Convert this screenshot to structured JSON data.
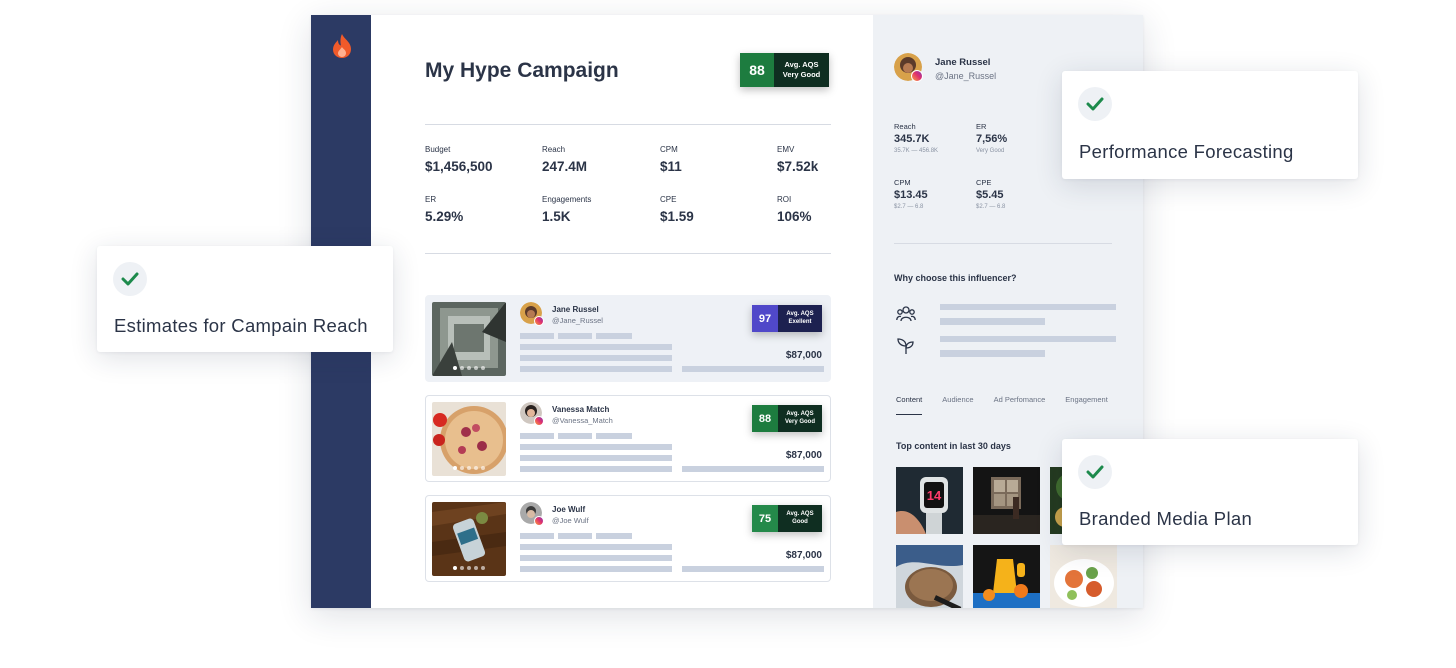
{
  "campaign": {
    "title": "My Hype Campaign",
    "aqs": {
      "score": "88",
      "label": "Avg. AQS",
      "rating": "Very Good",
      "color": "#1d7c3f"
    },
    "stats": [
      {
        "key": "Budget",
        "value": "$1,456,500"
      },
      {
        "key": "Reach",
        "value": "247.4M"
      },
      {
        "key": "CPM",
        "value": "$11"
      },
      {
        "key": "EMV",
        "value": "$7.52k"
      },
      {
        "key": "ER",
        "value": "5.29%"
      },
      {
        "key": "Engagements",
        "value": "1.5K"
      },
      {
        "key": "CPE",
        "value": "$1.59"
      },
      {
        "key": "ROI",
        "value": "106%"
      }
    ]
  },
  "influencers": [
    {
      "name": "Jane Russel",
      "handle": "@Jane_Russel",
      "aqs_score": "97",
      "aqs_label": "Avg. AQS",
      "aqs_rating": "Exellent",
      "price": "$87,000"
    },
    {
      "name": "Vanessa Match",
      "handle": "@Vanessa_Match",
      "aqs_score": "88",
      "aqs_label": "Avg. AQS",
      "aqs_rating": "Very Good",
      "price": "$87,000"
    },
    {
      "name": "Joe Wulf",
      "handle": "@Joe Wulf",
      "aqs_score": "75",
      "aqs_label": "Avg. AQS",
      "aqs_rating": "Good",
      "price": "$87,000"
    }
  ],
  "profile": {
    "name": "Jane Russel",
    "handle": "@Jane_Russel",
    "stats": [
      {
        "key": "Reach",
        "value": "345.7K",
        "sub": "35.7K — 456.8K"
      },
      {
        "key": "ER",
        "value": "7,56%",
        "sub": "Very Good"
      },
      {
        "key": "CPM",
        "value": "$13.45",
        "sub": "$2.7 — 6.8"
      },
      {
        "key": "CPE",
        "value": "$5.45",
        "sub": "$2.7 — 6.8"
      }
    ],
    "why_title": "Why choose this influencer?",
    "tabs": [
      "Content",
      "Audience",
      "Ad Perfomance",
      "Engagement"
    ],
    "active_tab": "Content",
    "top_content_title": "Top content in last 30 days",
    "watch_digits": "14"
  },
  "features": {
    "performance": "Performance Forecasting",
    "reach": "Estimates for Campain Reach",
    "media": "Branded Media Plan"
  },
  "colors": {
    "sidebar": "#2c3a64",
    "brand_flame": "#f05a2a",
    "aqs_excellent": "#5048c9",
    "aqs_green": "#1d7c3f",
    "check_green": "#1d8a4c"
  },
  "icons": [
    "flame-logo-icon",
    "instagram-icon",
    "check-icon",
    "audience-icon",
    "sprout-icon"
  ]
}
